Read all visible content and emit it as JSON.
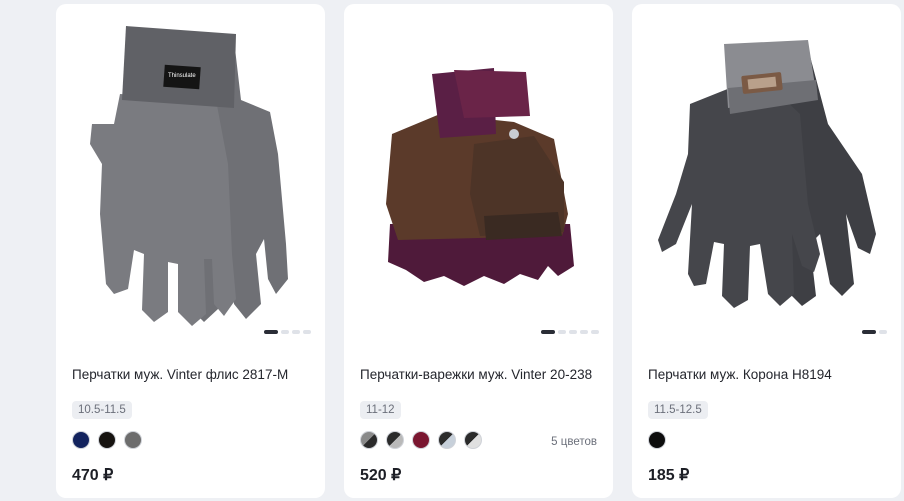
{
  "products": [
    {
      "title": "Перчатки муж. Vinter флис 2817-М",
      "size": "10.5-11.5",
      "price": "470 ₽",
      "colors": [
        "#13235e",
        "#161310",
        "#6d6d6d"
      ],
      "label_brand": "Thinsulate"
    },
    {
      "title": "Перчатки-варежки муж. Vinter 20-238",
      "size": "11-12",
      "price": "520 ₽",
      "colors": [
        "#8a8a8a/#2b2b2b",
        "#2b2b2b/#b9b9b9",
        "#7a1630",
        "#2b2b2b/#c7d0da",
        "#2b2b2b/#e0e0e0"
      ],
      "colors_count": "5 цветов"
    },
    {
      "title": "Перчатки муж. Корона H8194",
      "size": "11.5-12.5",
      "price": "185 ₽",
      "colors": [
        "#0d0d0d"
      ]
    }
  ]
}
